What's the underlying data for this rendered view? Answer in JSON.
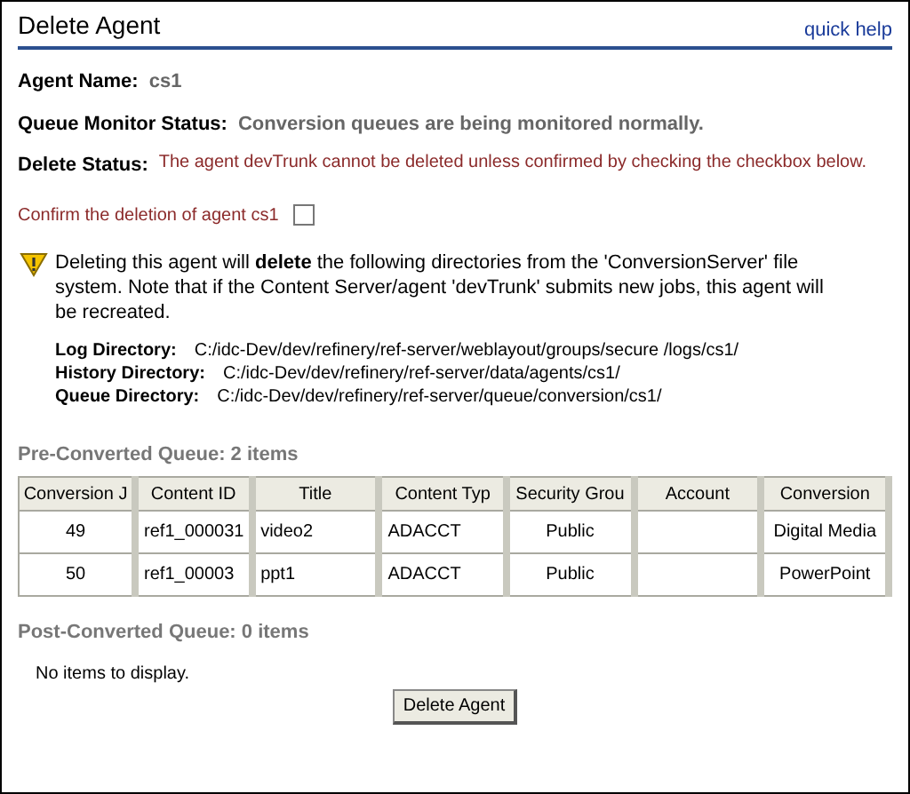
{
  "header": {
    "title": "Delete Agent",
    "help_link": "quick help"
  },
  "info": [
    {
      "label": "Agent Name:",
      "value": "cs1",
      "kind": "plain"
    },
    {
      "label": "Queue Monitor Status:",
      "value": "Conversion queues are being monitored normally.",
      "kind": "plain"
    },
    {
      "label": "Delete Status:",
      "value": "The agent devTrunk cannot be deleted unless confirmed by checking the checkbox below.",
      "kind": "alert"
    }
  ],
  "confirm": {
    "label": "Confirm the deletion of agent cs1",
    "checked": false
  },
  "warning": {
    "text": "Deleting this agent will **delete** the following directories from the 'ConversionServer' file system. Note that if the Content Server/agent 'devTrunk' submits new jobs, this agent will be recreated.",
    "directories": [
      {
        "label": "Log Directory:",
        "path": "C:/idc-Dev/dev/refinery/ref-server/weblayout/groups/secure /logs/cs1/"
      },
      {
        "label": "History Directory:",
        "path": "C:/idc-Dev/dev/refinery/ref-server/data/agents/cs1/"
      },
      {
        "label": "Queue Directory:",
        "path": "C:/idc-Dev/dev/refinery/ref-server/queue/conversion/cs1/"
      }
    ]
  },
  "pre_queue": {
    "heading": "Pre-Converted Queue: 2 items",
    "columns": [
      "Conversion J",
      "Content ID",
      "Title",
      "Content Typ",
      "Security Grou",
      "Account",
      "Conversion"
    ],
    "rows": [
      [
        "49",
        "ref1_000031",
        "video2",
        "ADACCT",
        "Public",
        "",
        "Digital Media"
      ],
      [
        "50",
        "ref1_00003",
        "ppt1",
        "ADACCT",
        "Public",
        "",
        "PowerPoint"
      ]
    ]
  },
  "post_queue": {
    "heading": "Post-Converted Queue: 0 items",
    "empty_text": "No items to display."
  },
  "delete_button": "Delete Agent"
}
